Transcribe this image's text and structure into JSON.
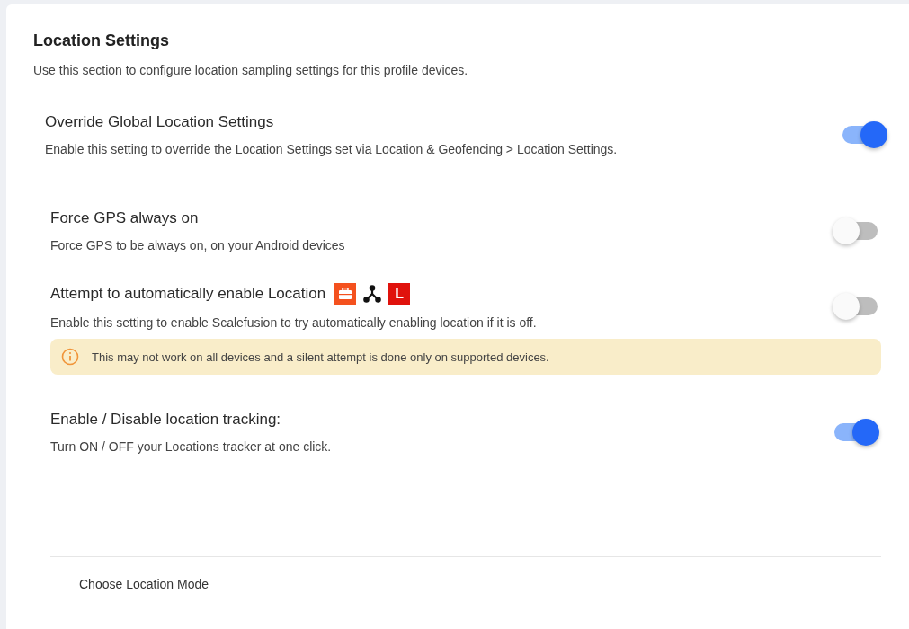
{
  "section": {
    "title": "Location Settings",
    "description": "Use this section to configure location sampling settings for this profile devices."
  },
  "override": {
    "title": "Override Global Location Settings",
    "description": "Enable this setting to override the Location Settings set via Location & Geofencing > Location Settings.",
    "on": true
  },
  "settings": [
    {
      "title": "Force GPS always on",
      "description": "Force GPS to be always on, on your Android devices",
      "on": false
    },
    {
      "title": "Attempt to automatically enable Location",
      "description": "Enable this setting to enable Scalefusion to try automatically enabling location if it is off.",
      "on": false,
      "badges": [
        {
          "kind": "briefcase",
          "color": "#f4511e"
        },
        {
          "kind": "nodes",
          "color": "#111111"
        },
        {
          "kind": "letter",
          "text": "L",
          "color": "#e0120c"
        }
      ],
      "notice": "This may not work on all devices and a silent attempt is done only on supported devices."
    },
    {
      "title": "Enable / Disable location tracking:",
      "description": "Turn ON / OFF your Locations tracker at one click.",
      "on": true
    }
  ],
  "mode": {
    "label": "Choose Location Mode"
  }
}
